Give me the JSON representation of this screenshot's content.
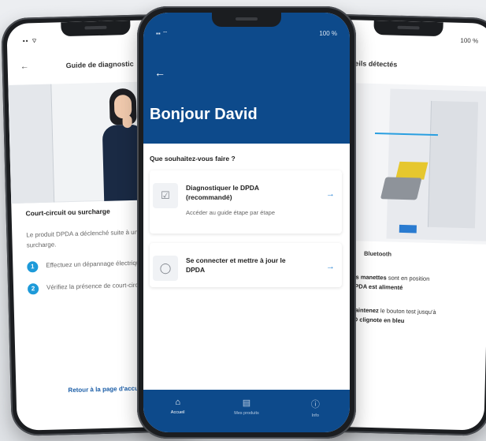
{
  "left_screen": {
    "title": "Guide de diagnostic",
    "section_title": "Court-circuit ou surcharge",
    "description": "Le produit DPDA a déclenché suite à un court-circuit ou surcharge.",
    "steps": [
      {
        "number": "1",
        "text": "Effectuez un dépannage électrique standard"
      },
      {
        "number": "2",
        "text": "Vérifiez la présence de court-circuit ou surcharge"
      }
    ],
    "link": "Retour à la page d'accueil"
  },
  "center_screen": {
    "greeting": "Bonjour David",
    "question": "Que souhaitez-vous faire ?",
    "battery": "100 %",
    "cards": [
      {
        "title": "Diagnostiquer le DPDA (recommandé)",
        "subtitle": "Accéder au guide étape par étape",
        "icon": "checklist-icon"
      },
      {
        "title": "Se connecter et mettre à jour le DPDA",
        "subtitle": "",
        "icon": "circle-icon"
      }
    ],
    "nav": [
      {
        "label": "Accueil",
        "icon": "home-icon",
        "active": true
      },
      {
        "label": "Mes produits",
        "icon": "document-icon",
        "active": false
      },
      {
        "label": "Info",
        "icon": "info-icon",
        "active": false
      }
    ]
  },
  "right_screen": {
    "title": "Appareils détectés",
    "battery": "100 %",
    "section_title": "Bluetooth",
    "p1_a": "les manettes",
    "p1_b": "sont en position",
    "p1_c": "DPDA est alimenté",
    "p2_a": "maintenez",
    "p2_b": "le bouton test jusqu'à",
    "p2_c": "ED clignote en bleu"
  },
  "colors": {
    "brand_blue": "#0d4a8b",
    "accent_blue": "#1d9ad9",
    "link_blue": "#1d5fa8"
  }
}
